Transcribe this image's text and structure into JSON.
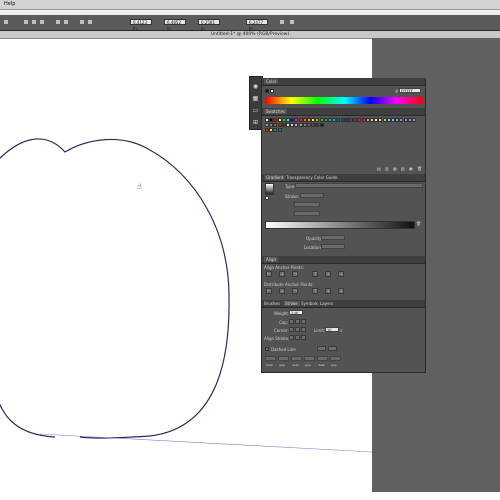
{
  "menubar": {
    "help_label": "Help"
  },
  "control_bar": {
    "field_1": "0.4123 in",
    "field_2": "6.4852 in",
    "field_3": "0.2581 in",
    "field_4": "6.2477 in"
  },
  "document": {
    "tab_title": "Untitled-1* @ 400% (RGB/Preview)"
  },
  "color_panel": {
    "tab_label": "Color",
    "hex_value": "FFFFFF",
    "accent": "#ffffff"
  },
  "swatches_panel": {
    "tab_label": "Swatches"
  },
  "gradient_panel": {
    "tabs": [
      "Gradient",
      "Transparency",
      "Color Guide"
    ],
    "type_label": "Type:",
    "stroke_label": "Stroke:",
    "opacity_label": "Opacity:",
    "location_label": "Location:"
  },
  "align_panel": {
    "tab_label": "Align",
    "align_anchor_label": "Align Anchor Points:",
    "distribute_anchor_label": "Distribute Anchor Points:"
  },
  "stroke_panel": {
    "tabs": [
      "Brushes",
      "Stroke",
      "Symbols",
      "Layers"
    ],
    "weight_label": "Weight:",
    "weight_value": "1 pt",
    "cap_label": "Cap:",
    "corner_label": "Corner:",
    "limit_label": "Limit:",
    "limit_value": "10",
    "align_stroke_label": "Align Stroke:",
    "dashed_line_label": "Dashed Line",
    "dash_labels": [
      "dash",
      "gap",
      "dash",
      "gap",
      "dash",
      "gap"
    ]
  },
  "icons": [
    "color-icon",
    "swatches-icon",
    "gradient-icon",
    "align-icon"
  ],
  "colors": {
    "path_stroke": "#2c2c5a",
    "pasteboard": "#606060",
    "panel_bg": "#535353"
  }
}
